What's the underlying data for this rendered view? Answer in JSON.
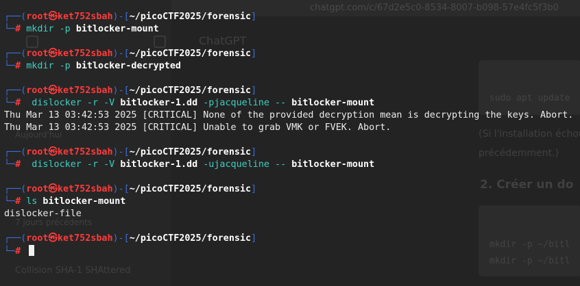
{
  "background": {
    "url_text": "chatgpt.com/c/67d2e5c0-8534-8007-b098-57e4fc5f3b0",
    "title": "ChatGPT",
    "snippets": [
      "sudo apt update",
      "(Si l'installation échoue",
      "précédemment.)",
      "2. Créer un do",
      "mkdir -p ~/bitl",
      "mkdir -p ~/bitl",
      "Aujourd'hui",
      "7 jours précédents",
      "Collision SHA-1 SHAttered"
    ]
  },
  "prompt": {
    "user": "root",
    "at": "㉿",
    "host": "ket752sbah",
    "path": "~/picoCTF2025/forensic",
    "symbol": "#"
  },
  "blocks": [
    {
      "cmd": "mkdir",
      "args": [
        {
          "t": "opt",
          "v": " -p "
        },
        {
          "t": "arg",
          "v": "bitlocker-mount"
        }
      ],
      "output": []
    },
    {
      "cmd": "mkdir",
      "args": [
        {
          "t": "opt",
          "v": " -p "
        },
        {
          "t": "arg",
          "v": "bitlocker-decrypted"
        }
      ],
      "output": []
    },
    {
      "cmd": " dislocker",
      "args": [
        {
          "t": "opt",
          "v": " -r -V "
        },
        {
          "t": "arg",
          "v": "bitlocker-1.dd"
        },
        {
          "t": "opt",
          "v": " -pjacqueline -- "
        },
        {
          "t": "arg",
          "v": "bitlocker-mount"
        }
      ],
      "output": [
        "Thu Mar 13 03:42:53 2025 [CRITICAL] None of the provided decryption mean is decrypting the keys. Abort.",
        "Thu Mar 13 03:42:53 2025 [CRITICAL] Unable to grab VMK or FVEK. Abort."
      ]
    },
    {
      "cmd": " dislocker",
      "args": [
        {
          "t": "opt",
          "v": " -r -V "
        },
        {
          "t": "arg",
          "v": "bitlocker-1.dd"
        },
        {
          "t": "opt",
          "v": " -ujacqueline -- "
        },
        {
          "t": "arg",
          "v": "bitlocker-mount"
        }
      ],
      "output": []
    },
    {
      "cmd": "ls",
      "args": [
        {
          "t": "arg",
          "v": " bitlocker-mount"
        }
      ],
      "output": [
        "dislocker-file"
      ]
    }
  ]
}
